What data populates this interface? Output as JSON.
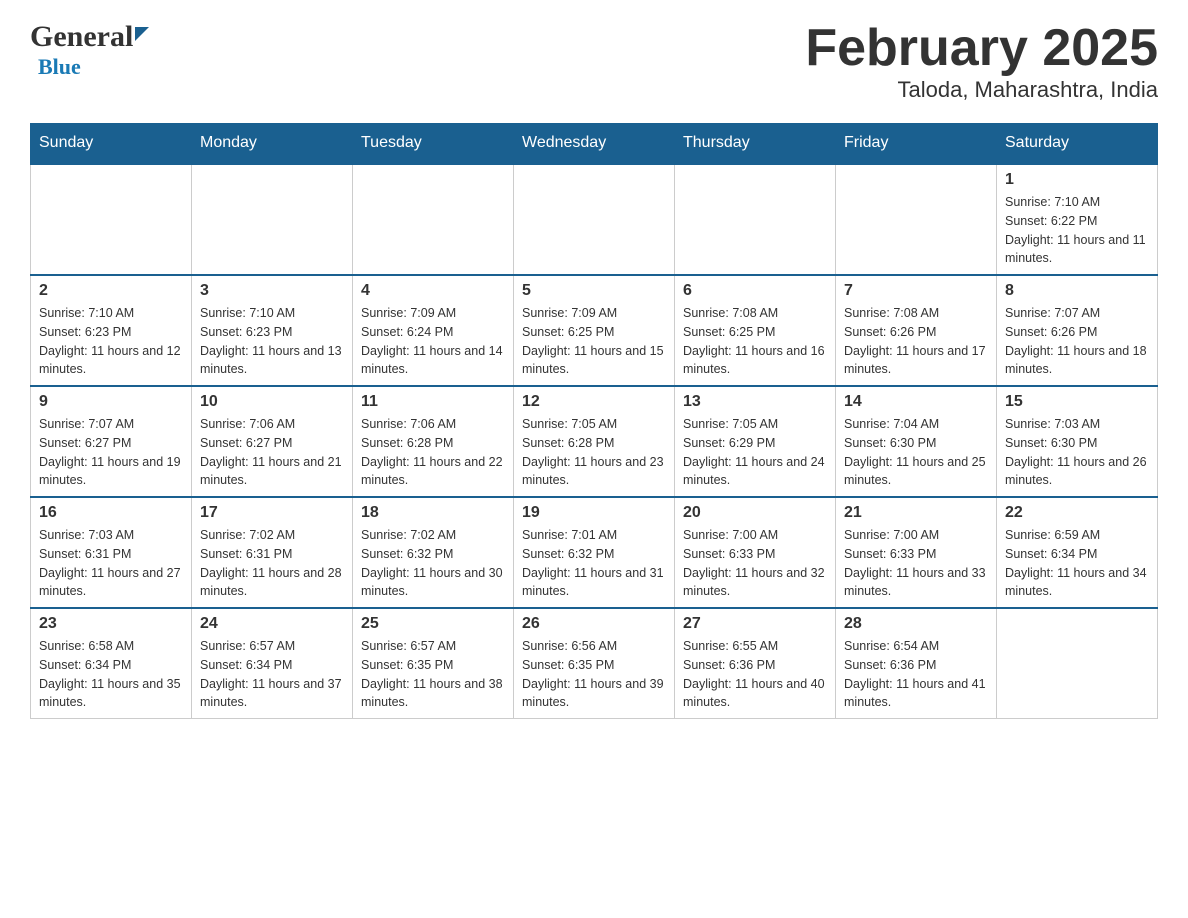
{
  "header": {
    "logo_general": "General",
    "logo_blue": "Blue",
    "title": "February 2025",
    "subtitle": "Taloda, Maharashtra, India"
  },
  "calendar": {
    "days_of_week": [
      "Sunday",
      "Monday",
      "Tuesday",
      "Wednesday",
      "Thursday",
      "Friday",
      "Saturday"
    ],
    "weeks": [
      {
        "cells": [
          {
            "date": "",
            "empty": true
          },
          {
            "date": "",
            "empty": true
          },
          {
            "date": "",
            "empty": true
          },
          {
            "date": "",
            "empty": true
          },
          {
            "date": "",
            "empty": true
          },
          {
            "date": "",
            "empty": true
          },
          {
            "date": "1",
            "sunrise": "Sunrise: 7:10 AM",
            "sunset": "Sunset: 6:22 PM",
            "daylight": "Daylight: 11 hours and 11 minutes."
          }
        ]
      },
      {
        "cells": [
          {
            "date": "2",
            "sunrise": "Sunrise: 7:10 AM",
            "sunset": "Sunset: 6:23 PM",
            "daylight": "Daylight: 11 hours and 12 minutes."
          },
          {
            "date": "3",
            "sunrise": "Sunrise: 7:10 AM",
            "sunset": "Sunset: 6:23 PM",
            "daylight": "Daylight: 11 hours and 13 minutes."
          },
          {
            "date": "4",
            "sunrise": "Sunrise: 7:09 AM",
            "sunset": "Sunset: 6:24 PM",
            "daylight": "Daylight: 11 hours and 14 minutes."
          },
          {
            "date": "5",
            "sunrise": "Sunrise: 7:09 AM",
            "sunset": "Sunset: 6:25 PM",
            "daylight": "Daylight: 11 hours and 15 minutes."
          },
          {
            "date": "6",
            "sunrise": "Sunrise: 7:08 AM",
            "sunset": "Sunset: 6:25 PM",
            "daylight": "Daylight: 11 hours and 16 minutes."
          },
          {
            "date": "7",
            "sunrise": "Sunrise: 7:08 AM",
            "sunset": "Sunset: 6:26 PM",
            "daylight": "Daylight: 11 hours and 17 minutes."
          },
          {
            "date": "8",
            "sunrise": "Sunrise: 7:07 AM",
            "sunset": "Sunset: 6:26 PM",
            "daylight": "Daylight: 11 hours and 18 minutes."
          }
        ]
      },
      {
        "cells": [
          {
            "date": "9",
            "sunrise": "Sunrise: 7:07 AM",
            "sunset": "Sunset: 6:27 PM",
            "daylight": "Daylight: 11 hours and 19 minutes."
          },
          {
            "date": "10",
            "sunrise": "Sunrise: 7:06 AM",
            "sunset": "Sunset: 6:27 PM",
            "daylight": "Daylight: 11 hours and 21 minutes."
          },
          {
            "date": "11",
            "sunrise": "Sunrise: 7:06 AM",
            "sunset": "Sunset: 6:28 PM",
            "daylight": "Daylight: 11 hours and 22 minutes."
          },
          {
            "date": "12",
            "sunrise": "Sunrise: 7:05 AM",
            "sunset": "Sunset: 6:28 PM",
            "daylight": "Daylight: 11 hours and 23 minutes."
          },
          {
            "date": "13",
            "sunrise": "Sunrise: 7:05 AM",
            "sunset": "Sunset: 6:29 PM",
            "daylight": "Daylight: 11 hours and 24 minutes."
          },
          {
            "date": "14",
            "sunrise": "Sunrise: 7:04 AM",
            "sunset": "Sunset: 6:30 PM",
            "daylight": "Daylight: 11 hours and 25 minutes."
          },
          {
            "date": "15",
            "sunrise": "Sunrise: 7:03 AM",
            "sunset": "Sunset: 6:30 PM",
            "daylight": "Daylight: 11 hours and 26 minutes."
          }
        ]
      },
      {
        "cells": [
          {
            "date": "16",
            "sunrise": "Sunrise: 7:03 AM",
            "sunset": "Sunset: 6:31 PM",
            "daylight": "Daylight: 11 hours and 27 minutes."
          },
          {
            "date": "17",
            "sunrise": "Sunrise: 7:02 AM",
            "sunset": "Sunset: 6:31 PM",
            "daylight": "Daylight: 11 hours and 28 minutes."
          },
          {
            "date": "18",
            "sunrise": "Sunrise: 7:02 AM",
            "sunset": "Sunset: 6:32 PM",
            "daylight": "Daylight: 11 hours and 30 minutes."
          },
          {
            "date": "19",
            "sunrise": "Sunrise: 7:01 AM",
            "sunset": "Sunset: 6:32 PM",
            "daylight": "Daylight: 11 hours and 31 minutes."
          },
          {
            "date": "20",
            "sunrise": "Sunrise: 7:00 AM",
            "sunset": "Sunset: 6:33 PM",
            "daylight": "Daylight: 11 hours and 32 minutes."
          },
          {
            "date": "21",
            "sunrise": "Sunrise: 7:00 AM",
            "sunset": "Sunset: 6:33 PM",
            "daylight": "Daylight: 11 hours and 33 minutes."
          },
          {
            "date": "22",
            "sunrise": "Sunrise: 6:59 AM",
            "sunset": "Sunset: 6:34 PM",
            "daylight": "Daylight: 11 hours and 34 minutes."
          }
        ]
      },
      {
        "cells": [
          {
            "date": "23",
            "sunrise": "Sunrise: 6:58 AM",
            "sunset": "Sunset: 6:34 PM",
            "daylight": "Daylight: 11 hours and 35 minutes."
          },
          {
            "date": "24",
            "sunrise": "Sunrise: 6:57 AM",
            "sunset": "Sunset: 6:34 PM",
            "daylight": "Daylight: 11 hours and 37 minutes."
          },
          {
            "date": "25",
            "sunrise": "Sunrise: 6:57 AM",
            "sunset": "Sunset: 6:35 PM",
            "daylight": "Daylight: 11 hours and 38 minutes."
          },
          {
            "date": "26",
            "sunrise": "Sunrise: 6:56 AM",
            "sunset": "Sunset: 6:35 PM",
            "daylight": "Daylight: 11 hours and 39 minutes."
          },
          {
            "date": "27",
            "sunrise": "Sunrise: 6:55 AM",
            "sunset": "Sunset: 6:36 PM",
            "daylight": "Daylight: 11 hours and 40 minutes."
          },
          {
            "date": "28",
            "sunrise": "Sunrise: 6:54 AM",
            "sunset": "Sunset: 6:36 PM",
            "daylight": "Daylight: 11 hours and 41 minutes."
          },
          {
            "date": "",
            "empty": true
          }
        ]
      }
    ]
  }
}
